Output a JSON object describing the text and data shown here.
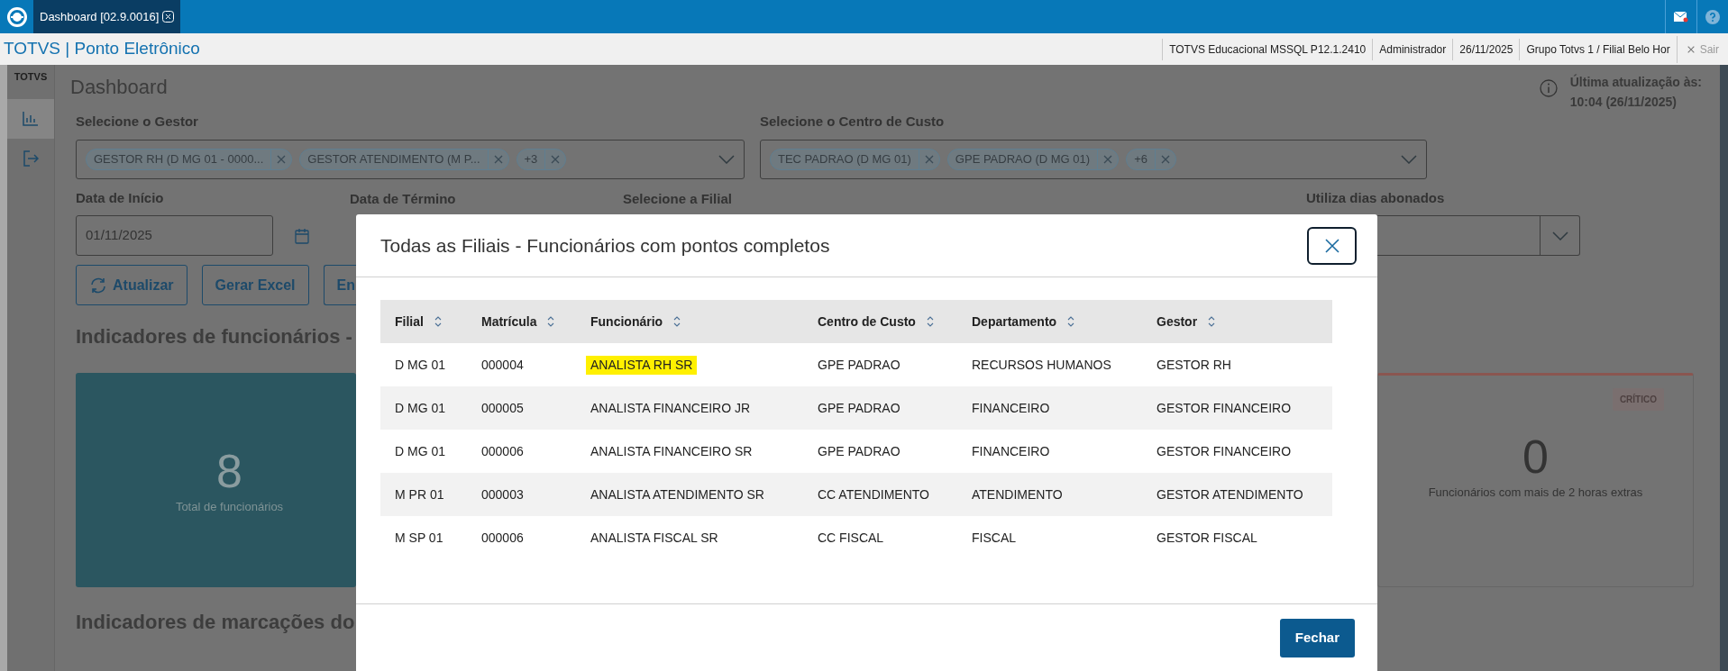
{
  "top_bar": {
    "tabs": [
      {
        "label": "Dashboard [02.9.0016]",
        "selected": true
      }
    ]
  },
  "header": {
    "app_title": "TOTVS | Ponto Eletrônico",
    "info": [
      "TOTVS Educacional MSSQL P12.1.2410",
      "Administrador",
      "26/11/2025",
      "Grupo Totvs 1 / Filial Belo Hor"
    ],
    "logout": "Sair"
  },
  "sidebar": {
    "logo": "TOTVS",
    "items": [
      {
        "kind": "chart",
        "selected": true
      },
      {
        "kind": "exit",
        "selected": false
      }
    ]
  },
  "page": {
    "title": "Dashboard",
    "last_update_label": "Última atualização às:",
    "last_update_value": "10:04 (26/11/2025)",
    "gestor": {
      "label": "Selecione o Gestor",
      "chips": [
        "GESTOR RH (D MG 01 - 0000...",
        "GESTOR ATENDIMENTO (M P...",
        "+3"
      ]
    },
    "centro_de_custo": {
      "label": "Selecione o Centro de Custo",
      "chips": [
        "TEC PADRAO (D MG 01)",
        "GPE PADRAO (D MG 01)",
        "+6"
      ]
    },
    "data_inicio": {
      "label": "Data de Início",
      "value": "01/11/2025"
    },
    "data_termino_label": "Data de Término",
    "filial_label": "Selecione a Filial",
    "dias_abonados_label": "Utiliza dias abonados",
    "buttons": [
      {
        "kind": "refresh",
        "label": "Atualizar"
      },
      {
        "kind": "plain",
        "label": "Gerar Excel"
      },
      {
        "kind": "plain",
        "label": "En"
      }
    ],
    "section_1": "Indicadores de funcionários -",
    "cards": [
      {
        "kind": "total",
        "value": "8",
        "label": "Total de funcionários"
      },
      {
        "kind": "critical",
        "value": "0",
        "label": "Funcionários com mais de 2 horas extras",
        "badge": "CRÍTICO"
      }
    ],
    "section_2": "Indicadores de marcações do"
  },
  "modal": {
    "title": "Todas as Filiais - Funcionários com pontos completos",
    "columns": [
      "Filial",
      "Matrícula",
      "Funcionário",
      "Centro de Custo",
      "Departamento",
      "Gestor"
    ],
    "rows": [
      {
        "cells": [
          "D MG 01",
          "000004",
          "ANALISTA RH SR",
          "GPE PADRAO",
          "RECURSOS HUMANOS",
          "GESTOR RH"
        ],
        "highlighted": true
      },
      {
        "cells": [
          "D MG 01",
          "000005",
          "ANALISTA FINANCEIRO JR",
          "GPE PADRAO",
          "FINANCEIRO",
          "GESTOR FINANCEIRO"
        ],
        "highlighted": false
      },
      {
        "cells": [
          "D MG 01",
          "000006",
          "ANALISTA FINANCEIRO SR",
          "GPE PADRAO",
          "FINANCEIRO",
          "GESTOR FINANCEIRO"
        ],
        "highlighted": false
      },
      {
        "cells": [
          "M PR 01",
          "000003",
          "ANALISTA ATENDIMENTO SR",
          "CC ATENDIMENTO",
          "ATENDIMENTO",
          "GESTOR ATENDIMENTO"
        ],
        "highlighted": false
      },
      {
        "cells": [
          "M SP 01",
          "000006",
          "ANALISTA FISCAL SR",
          "CC FISCAL",
          "FISCAL",
          "GESTOR FISCAL"
        ],
        "highlighted": false
      }
    ],
    "close_button": "Fechar"
  }
}
